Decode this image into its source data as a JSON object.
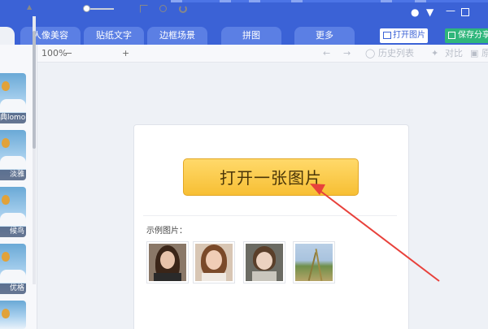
{
  "window": {
    "chat_icon": "chat-bubble-icon",
    "dropdown_icon": "chevron-down-icon",
    "minimize_icon": "minimize-icon",
    "maximize_icon": "maximize-icon"
  },
  "tabs": [
    {
      "label": "人像美容"
    },
    {
      "label": "贴纸文字"
    },
    {
      "label": "边框场景"
    },
    {
      "label": "拼图"
    },
    {
      "label": "更多"
    }
  ],
  "header_buttons": {
    "open_label": "打开图片",
    "save_label": "保存分享"
  },
  "toolbar": {
    "zoom": "100%",
    "zoom_out": "−",
    "zoom_in": "+",
    "undo": "←",
    "redo": "→",
    "history_label": "历史列表",
    "compare_label": "对比",
    "more_label": "原"
  },
  "thumbnails": [
    {
      "label": "典lomo"
    },
    {
      "label": "淡雅"
    },
    {
      "label": "候鸟"
    },
    {
      "label": "优格"
    },
    {
      "label": ""
    }
  ],
  "main": {
    "open_button_label": "打开一张图片",
    "sample_label": "示例图片："
  },
  "colors": {
    "brand_blue": "#3b62d6",
    "save_green": "#2fb67b",
    "open_button_yellow": "#f7bf34",
    "annotation_red": "#e8413b"
  }
}
